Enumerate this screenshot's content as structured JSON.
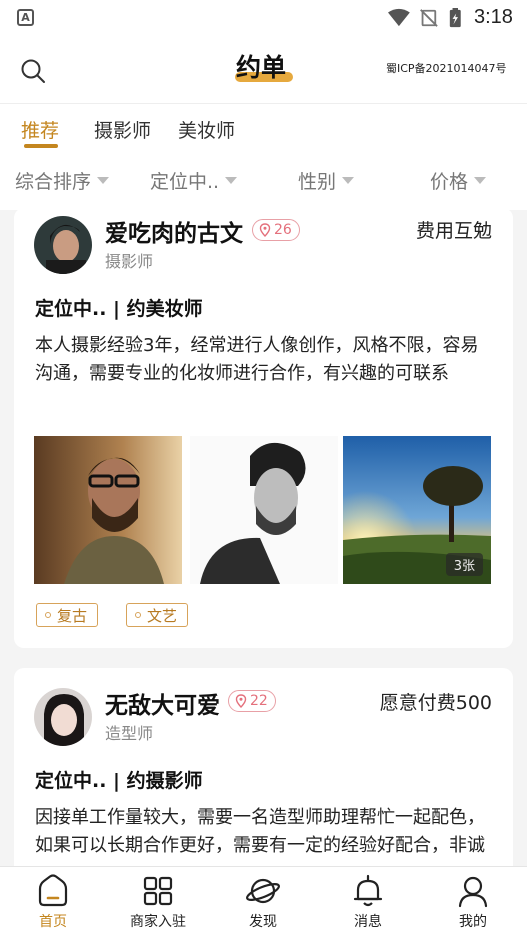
{
  "status_bar": {
    "time": "3:18",
    "app_icon_letter": "A"
  },
  "header": {
    "title": "约单",
    "icp": "蜀ICP备2021014047号"
  },
  "tabs": [
    {
      "label": "推荐",
      "active": true
    },
    {
      "label": "摄影师",
      "active": false
    },
    {
      "label": "美妆师",
      "active": false
    }
  ],
  "filters": [
    {
      "label": "综合排序"
    },
    {
      "label": "定位中.."
    },
    {
      "label": "性别"
    },
    {
      "label": "价格"
    }
  ],
  "posts": [
    {
      "name": "爱吃肉的古文",
      "badge": "26",
      "role": "摄影师",
      "fee": "费用互勉",
      "headline": "定位中.. | 约美妆师",
      "description": "本人摄影经验3年，经常进行人像创作，风格不限，容易沟通，需要专业的化妆师进行合作，有兴趣的可联系",
      "photo_count": "3张",
      "tags": [
        "复古",
        "文艺"
      ]
    },
    {
      "name": "无敌大可爱",
      "badge": "22",
      "role": "造型师",
      "fee": "愿意付费500",
      "headline": "定位中.. | 约摄影师",
      "description": "因接单工作量较大，需要一名造型师助理帮忙一起配色，如果可以长期合作更好，需要有一定的经验好配合，非诚勿扰的其他，希望能够找到"
    }
  ],
  "bottom_nav": [
    {
      "label": "首页",
      "icon": "home-icon",
      "active": true
    },
    {
      "label": "商家入驻",
      "icon": "grid-icon",
      "active": false
    },
    {
      "label": "发现",
      "icon": "planet-icon",
      "active": false
    },
    {
      "label": "消息",
      "icon": "bell-icon",
      "active": false
    },
    {
      "label": "我的",
      "icon": "user-icon",
      "active": false
    }
  ],
  "colors": {
    "accent": "#c4861f",
    "highlight": "#e6a93e",
    "badge": "#e4707c"
  }
}
